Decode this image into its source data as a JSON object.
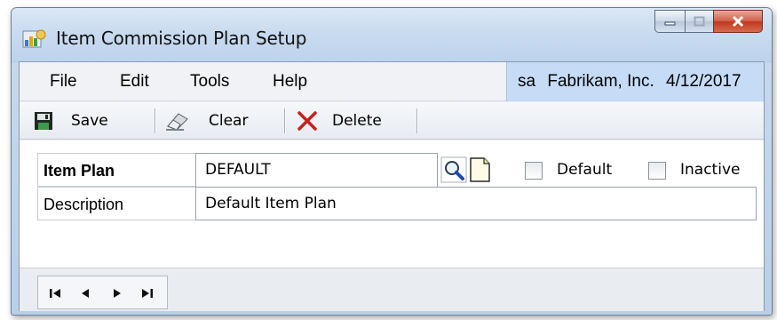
{
  "window": {
    "title": "Item Commission Plan Setup"
  },
  "menu": {
    "items": [
      "File",
      "Edit",
      "Tools",
      "Help"
    ]
  },
  "user_info": {
    "user": "sa",
    "company": "Fabrikam, Inc.",
    "date": "4/12/2017"
  },
  "toolbar": {
    "save_label": "Save",
    "clear_label": "Clear",
    "delete_label": "Delete"
  },
  "form": {
    "item_plan_label": "Item Plan",
    "item_plan_value": "DEFAULT",
    "description_label": "Description",
    "description_value": "Default Item Plan",
    "default_label": "Default",
    "default_checked": false,
    "inactive_label": "Inactive",
    "inactive_checked": false
  },
  "icons": {
    "app": "commission-plan-icon",
    "save": "floppy-disk-icon",
    "clear": "eraser-icon",
    "delete": "red-x-icon",
    "lookup": "magnifier-icon",
    "new": "new-document-icon",
    "nav_first": "first-record-icon",
    "nav_prev": "previous-record-icon",
    "nav_next": "next-record-icon",
    "nav_last": "last-record-icon"
  },
  "colors": {
    "title_gradient": "#c9dbef",
    "user_info_bg": "#c5dbf6",
    "close_button": "#c2371f",
    "delete_icon": "#c8201b"
  }
}
